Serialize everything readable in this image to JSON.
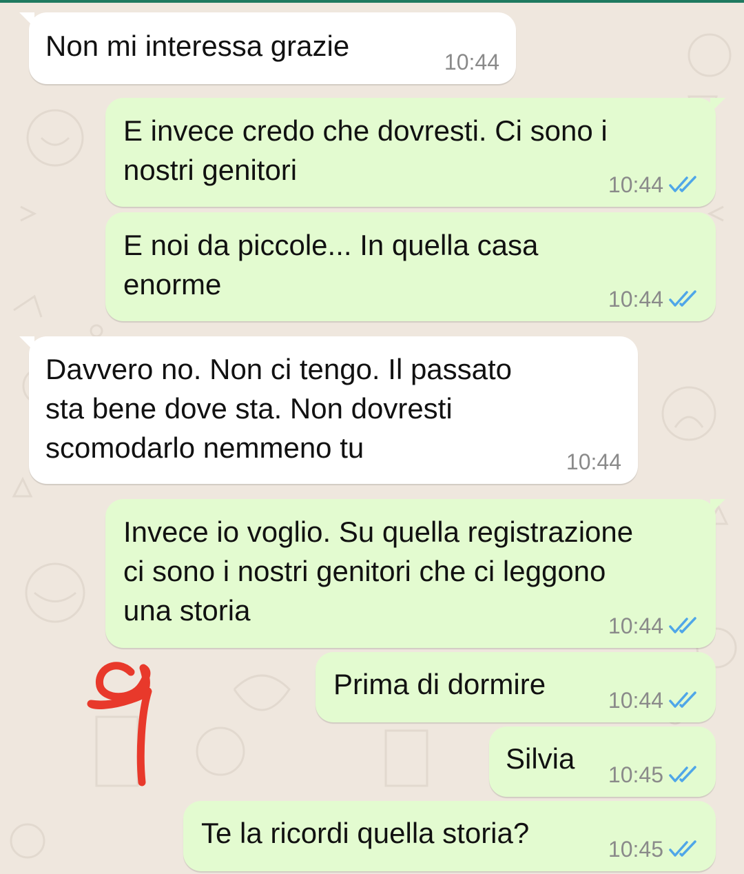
{
  "chat": {
    "messages": [
      {
        "direction": "incoming",
        "text": "Non mi interessa grazie",
        "time": "10:44"
      },
      {
        "direction": "outgoing",
        "text": "E invece credo che dovresti. Ci sono i\nnostri genitori",
        "time": "10:44",
        "status": "read"
      },
      {
        "direction": "outgoing",
        "text": "E noi da piccole... In quella casa\nenorme",
        "time": "10:44",
        "status": "read"
      },
      {
        "direction": "incoming",
        "text": "Davvero no. Non ci tengo. Il passato\nsta bene dove sta. Non dovresti\nscomodarlo nemmeno tu",
        "time": "10:44"
      },
      {
        "direction": "outgoing",
        "text": "Invece io voglio. Su quella registrazione\nci sono i nostri genitori che ci leggono\nuna storia",
        "time": "10:44",
        "status": "read"
      },
      {
        "direction": "outgoing",
        "text": "Prima di dormire",
        "time": "10:44",
        "status": "read"
      },
      {
        "direction": "outgoing",
        "text": "Silvia",
        "time": "10:45",
        "status": "read"
      },
      {
        "direction": "outgoing",
        "text": "Te la ricordi quella storia?",
        "time": "10:45",
        "status": "read"
      }
    ]
  },
  "icons": {
    "read_receipt": "double-check-icon"
  },
  "colors": {
    "background": "#efe7de",
    "incoming_bubble": "#ffffff",
    "outgoing_bubble": "#e3fbd0",
    "read_tick": "#4fa6e8",
    "annotation": "#e8392b",
    "header_line": "#1f7a60"
  }
}
